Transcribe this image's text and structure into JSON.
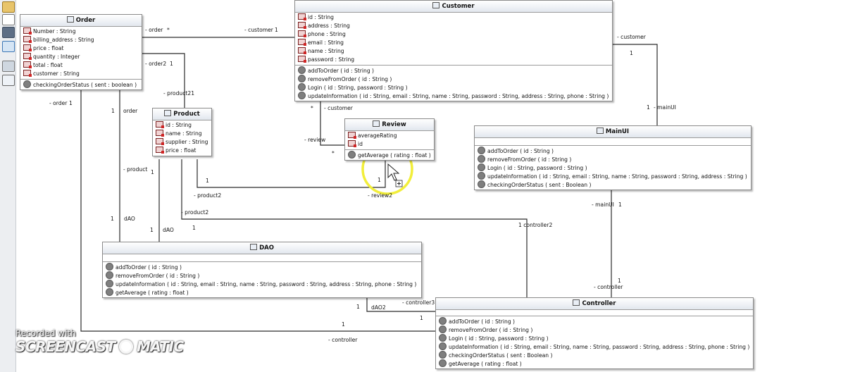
{
  "diagram": {
    "classes": {
      "order": {
        "name": "Order",
        "attributes": [
          "Number : String",
          "billing_address : String",
          "price : float",
          "quantity : Integer",
          "total : float",
          "customer : String"
        ],
        "operations": [
          "checkingOrderStatus ( sent : boolean )"
        ]
      },
      "customer": {
        "name": "Customer",
        "attributes": [
          "id : String",
          "address : String",
          "phone : String",
          "email : String",
          "name : String",
          "password : String"
        ],
        "operations": [
          "addToOrder ( id : String )",
          "removeFromOrder ( id : String )",
          "Login ( id : String, password : String )",
          "updateInformation ( id : String, email : String, name : String, password : String, address : String, phone : String )"
        ]
      },
      "product": {
        "name": "Product",
        "attributes": [
          "id : String",
          "name : String",
          "supplier : String",
          "price : float"
        ],
        "operations": []
      },
      "review": {
        "name": "Review",
        "attributes": [
          "averageRating",
          "id"
        ],
        "operations": [
          "getAverage ( rating : float )"
        ]
      },
      "mainui": {
        "name": "MainUI",
        "attributes": [],
        "operations": [
          "addToOrder ( id : String )",
          "removeFromOrder ( id : String )",
          "Login ( id : String, password : String )",
          "updateInformation ( id : String, email : String, name : String, password : String, address : String )",
          "checkingOrderStatus ( sent : Boolean )"
        ]
      },
      "dao": {
        "name": "DAO",
        "attributes": [],
        "operations": [
          "addToOrder ( id : String )",
          "removeFromOrder ( id : String )",
          "updateInformation ( id : String, email : String, name : String, password : String, address : String, phone : String )",
          "getAverage ( rating : float )"
        ]
      },
      "controller": {
        "name": "Controller",
        "attributes": [],
        "operations": [
          "addToOrder ( id : String )",
          "removeFromOrder ( id : String )",
          "Login ( id : String, password : String )",
          "updateInformation ( id : String, email : String, name : String, password : String, address : String, phone : String )",
          "checkingOrderStatus ( sent : Boolean )",
          "getAverage ( rating : float )"
        ]
      }
    },
    "role_labels": [
      "- order",
      "*",
      "- customer",
      "1",
      "- order2",
      "1",
      "- product21",
      "- order",
      "1",
      "1",
      "order",
      "- customer",
      "*",
      "- review",
      "*",
      "- customer",
      "1",
      "1",
      "- mainUI",
      "- product",
      "1",
      "1",
      "- product2",
      "- review2",
      "1",
      "- mainUI",
      "1",
      "- product2",
      "1",
      "dAO",
      "1",
      "dAO",
      "1",
      "1 controller2",
      "1",
      "- controller",
      "- controller3",
      "1",
      "dAO2",
      "1",
      "- controller"
    ]
  },
  "watermark": {
    "recorded": "Recorded with",
    "brand_left": "SCREENCAST",
    "brand_right": "MATIC"
  },
  "colors": {
    "attribute_icon": "#d02525",
    "operation_icon": "#7f7f7f",
    "header_gradient_end": "#e2e7ee",
    "cursor_highlight": "#f2ee3a"
  }
}
